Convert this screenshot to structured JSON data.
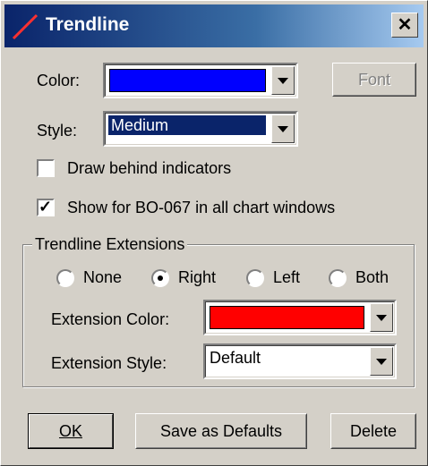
{
  "window": {
    "title": "Trendline",
    "close_label": "✕"
  },
  "colors": {
    "line_color": "#0000ff",
    "extension_color": "#ff0000",
    "title_gradient_start": "#0a246a",
    "title_gradient_end": "#a6caf0"
  },
  "fields": {
    "color_label": "Color:",
    "font_button": "Font",
    "style_label": "Style:",
    "style_value": "Medium"
  },
  "options": {
    "draw_behind_label": "Draw behind indicators",
    "draw_behind_checked": false,
    "show_all_label": "Show for BO-067 in all chart windows",
    "show_all_checked": true
  },
  "extensions": {
    "group_title": "Trendline Extensions",
    "radios": [
      {
        "label": "None",
        "selected": false
      },
      {
        "label": "Right",
        "selected": true
      },
      {
        "label": "Left",
        "selected": false
      },
      {
        "label": "Both",
        "selected": false
      }
    ],
    "ext_color_label": "Extension Color:",
    "ext_style_label": "Extension Style:",
    "ext_style_value": "Default"
  },
  "buttons": {
    "ok": "OK",
    "save_defaults": "Save as Defaults",
    "delete": "Delete"
  },
  "icons": {
    "title": "trendline-icon",
    "close": "close-icon",
    "dropdown": "chevron-down-icon"
  }
}
